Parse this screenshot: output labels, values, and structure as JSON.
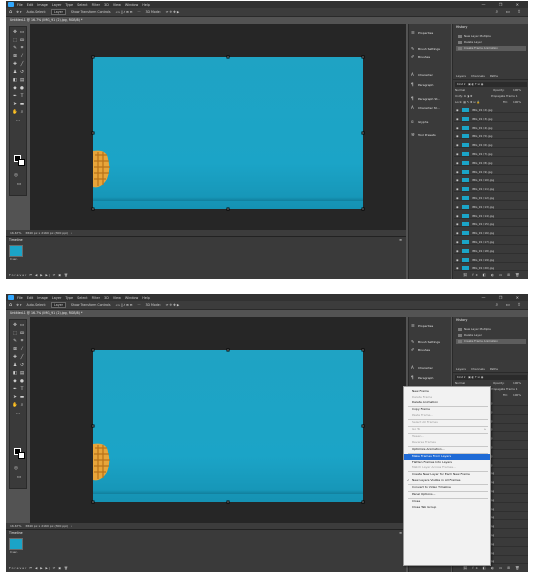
{
  "menubar": {
    "items": [
      "File",
      "Edit",
      "Image",
      "Layer",
      "Type",
      "Select",
      "Filter",
      "3D",
      "View",
      "Window",
      "Help"
    ],
    "window_controls": "— ❐ ✕"
  },
  "options_bar": {
    "auto_select_label": "Auto-Select:",
    "auto_select_value": "Layer",
    "show_transform_label": "Show Transform Controls",
    "mode_3d_label": "3D Mode:",
    "right_icons": "⌕ ▭ ⇪"
  },
  "document": {
    "tab_title": "Untitled-1 @ 16.7% (IMG_91 (2).jpg, RGB/8) *",
    "tab_title_short": "Untitled-1 @ 16.7% (IMG_91 (2).jpg, RGB/8) *"
  },
  "statusbar": {
    "zoom": "16.67%",
    "doc_size": "3840 px x 2160 px (300 ppi)"
  },
  "timeline": {
    "title": "Timeline",
    "frame_delay": "0 sec.",
    "loop": "Forever",
    "controls": "⏮ ◀ ▶ ▶| ⟳ ▣ 🗑"
  },
  "mid_panel": {
    "items": [
      {
        "icon": "properties",
        "label": "Properties"
      },
      {
        "icon": "brush-settings",
        "label": "Brush Settings"
      },
      {
        "icon": "brushes",
        "label": "Brushes"
      },
      {
        "icon": "character",
        "label": "Character"
      },
      {
        "icon": "paragraph",
        "label": "Paragraph"
      },
      {
        "icon": "paragraph-styles",
        "label": "Paragraph St..."
      },
      {
        "icon": "character-styles",
        "label": "Character St..."
      },
      {
        "icon": "glyphs",
        "label": "Glyphs"
      },
      {
        "icon": "tool-presets",
        "label": "Tool Presets"
      }
    ]
  },
  "history": {
    "tab": "History",
    "items": [
      "New Layer Multiple",
      "Delete Layer",
      "Create Frame Animation"
    ],
    "selected_index": 2
  },
  "layers": {
    "tabs": [
      "Layers",
      "Channels",
      "Paths"
    ],
    "kind_label": "Kind",
    "blend_mode": "Normal",
    "opacity_label": "Opacity:",
    "opacity_value": "100%",
    "unify_label": "Unify:",
    "propagate_label": "Propagate Frame 1",
    "lock_label": "Lock:",
    "fill_label": "Fill:",
    "fill_value": "100%",
    "rows": [
      "IMG_91 (2).jpg",
      "IMG_91 (3).jpg",
      "IMG_91 (4).jpg",
      "IMG_91 (5).jpg",
      "IMG_91 (6).jpg",
      "IMG_91 (7).jpg",
      "IMG_91 (8).jpg",
      "IMG_91 (9).jpg",
      "IMG_91 (10).jpg",
      "IMG_91 (11).jpg",
      "IMG_91 (12).jpg",
      "IMG_91 (13).jpg",
      "IMG_91 (14).jpg",
      "IMG_91 (15).jpg",
      "IMG_91 (16).jpg",
      "IMG_91 (17).jpg",
      "IMG_91 (18).jpg",
      "IMG_91 (19).jpg",
      "IMG_91 (20).jpg"
    ]
  },
  "context_menu": {
    "items": [
      {
        "label": "New Frame",
        "state": "normal"
      },
      {
        "label": "Delete Frame",
        "state": "disabled"
      },
      {
        "label": "Delete Animation",
        "state": "normal"
      },
      {
        "sep": true
      },
      {
        "label": "Copy Frame",
        "state": "normal"
      },
      {
        "label": "Paste Frame...",
        "state": "disabled"
      },
      {
        "sep": true
      },
      {
        "label": "Select All Frames",
        "state": "disabled"
      },
      {
        "sep": true
      },
      {
        "label": "Go To",
        "state": "disabled",
        "submenu": true
      },
      {
        "sep": true
      },
      {
        "label": "Tween...",
        "state": "disabled"
      },
      {
        "label": "Reverse Frames",
        "state": "disabled"
      },
      {
        "sep": true
      },
      {
        "label": "Optimize Animation...",
        "state": "normal"
      },
      {
        "sep": true
      },
      {
        "label": "Make Frames From Layers",
        "state": "highlighted"
      },
      {
        "label": "Flatten Frames Into Layers",
        "state": "normal"
      },
      {
        "label": "Match Layer Across Frames...",
        "state": "disabled"
      },
      {
        "sep": true
      },
      {
        "label": "Create New Layer for Each New Frame",
        "state": "normal"
      },
      {
        "label": "New Layers Visible in All Frames",
        "state": "checked"
      },
      {
        "sep": true
      },
      {
        "label": "Convert to Video Timeline",
        "state": "normal"
      },
      {
        "sep": true
      },
      {
        "label": "Panel Options...",
        "state": "normal"
      },
      {
        "sep": true
      },
      {
        "label": "Close",
        "state": "normal"
      },
      {
        "label": "Close Tab Group",
        "state": "normal"
      }
    ]
  },
  "colors": {
    "ps_blue": "#31a8ff",
    "canvas_cyan": "#1ba4c7",
    "menu_highlight": "#1e6ad6"
  }
}
